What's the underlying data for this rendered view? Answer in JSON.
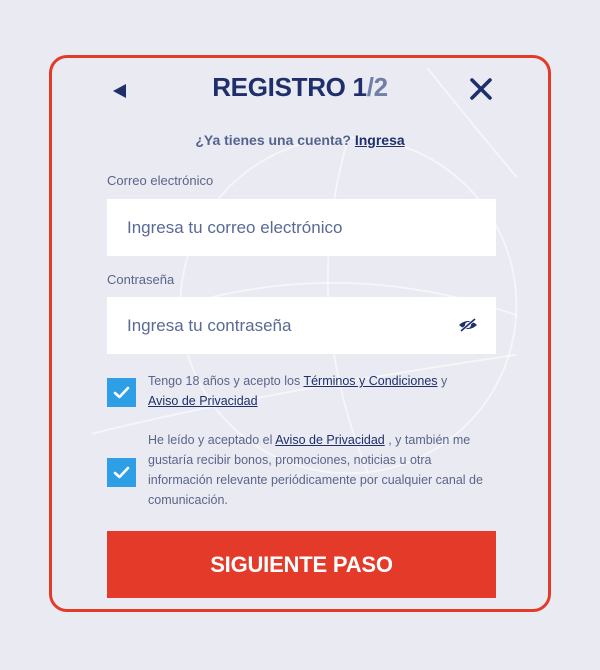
{
  "header": {
    "title": "REGISTRO 1",
    "title_sep": "/",
    "title_total": "2"
  },
  "login_prompt": {
    "question": "¿Ya tienes una cuenta?",
    "link": "Ingresa"
  },
  "email": {
    "label": "Correo electrónico",
    "placeholder": "Ingresa tu correo electrónico",
    "value": ""
  },
  "password": {
    "label": "Contraseña",
    "placeholder": "Ingresa tu contraseña",
    "value": ""
  },
  "terms": {
    "checked": true,
    "text_before": "Tengo 18 años y acepto los ",
    "link_terms": "Términos y Condiciones",
    "text_and": " y",
    "link_privacy": "Aviso de Privacidad"
  },
  "marketing": {
    "checked": true,
    "text_before": "He leído y aceptado el ",
    "link_privacy": "Aviso de Privacidad",
    "text_after": " , y también me gustaría recibir bonos, promociones, noticias u otra información relevante periódicamente por cualquier canal de comunicación."
  },
  "submit_label": "SIGUIENTE PASO",
  "colors": {
    "accent": "#e33a29",
    "navy": "#1e2f6b",
    "checkbox": "#2e9ee6",
    "background": "#e9eaf2"
  },
  "icons": {
    "back": "back-arrow-icon",
    "close": "close-icon",
    "password_toggle": "eye-slash-icon",
    "checkbox": "checkmark-icon"
  }
}
